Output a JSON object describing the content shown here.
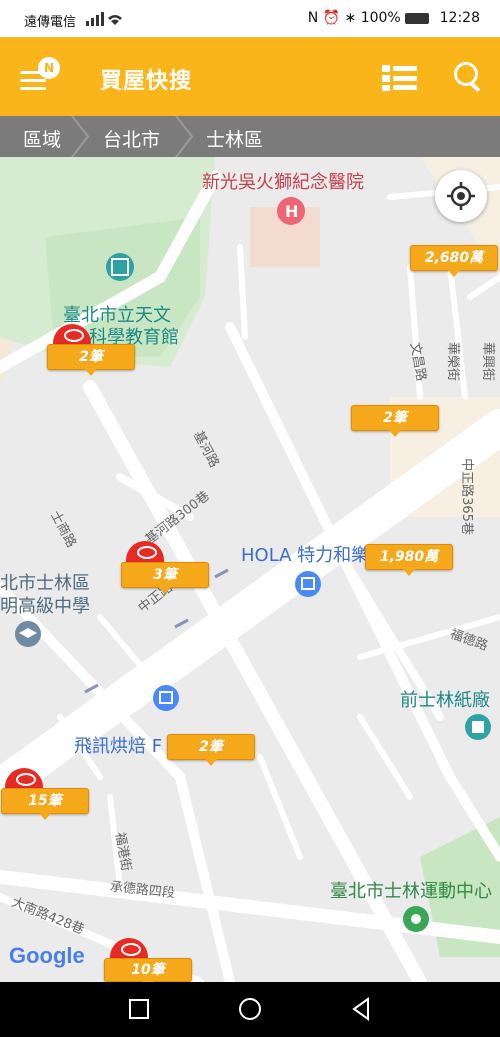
{
  "status_bar": {
    "carrier": "遠傳電信",
    "battery": "100%",
    "time": "12:28"
  },
  "header": {
    "title": "買屋快搜",
    "menu_badge": "N",
    "icons": [
      "menu-icon",
      "list-view-icon",
      "search-icon"
    ]
  },
  "breadcrumb": {
    "items": [
      "區域",
      "台北市",
      "士林區"
    ]
  },
  "map": {
    "places": [
      "新光吳火獅紀念醫院",
      "臺北市立天文",
      "科學教育館",
      "HOLA 特力和樂",
      "北市士林區",
      "明高級中學",
      "前士林紙廠",
      "飛訊烘焙 F",
      "臺北市士林運動中心"
    ],
    "roads": [
      "文昌路",
      "華榮街",
      "華興街",
      "基河路",
      "基河路300巷",
      "中正路365巷",
      "士商路",
      "中正路",
      "福德路",
      "福港街",
      "承德路四段",
      "大南路428巷"
    ],
    "markers": [
      "2,680萬",
      "2筆",
      "2筆",
      "1,980萬",
      "3筆",
      "2筆",
      "15筆",
      "10筆"
    ],
    "google_logo": "Google"
  },
  "colors": {
    "header": "#f9b51a",
    "breadcrumb": "#7b7b7b",
    "marker": "#f6a81b",
    "marker_badge": "#e52b24"
  }
}
